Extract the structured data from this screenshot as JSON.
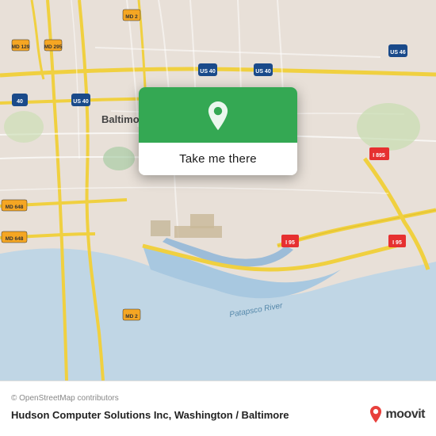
{
  "map": {
    "alt": "Map of Baltimore area",
    "background_color": "#e8e0d8"
  },
  "popup": {
    "button_label": "Take me there",
    "pin_color": "#34a853",
    "header_bg": "#34a853"
  },
  "footer": {
    "copyright": "© OpenStreetMap contributors",
    "company_name": "Hudson Computer Solutions Inc, Washington / Baltimore",
    "moovit_label": "moovit"
  }
}
